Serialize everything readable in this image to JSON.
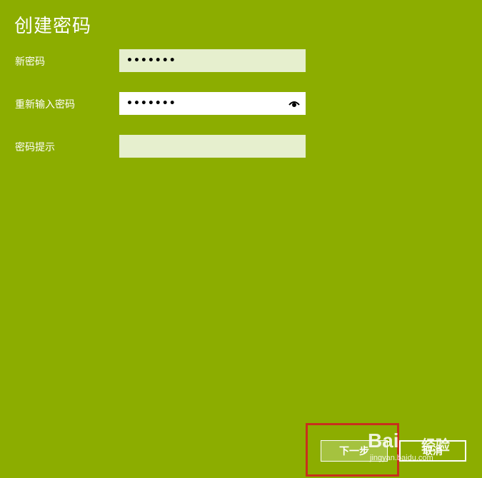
{
  "window": {
    "title": "创建密码"
  },
  "form": {
    "new_password": {
      "label": "新密码",
      "value": "•••••••"
    },
    "confirm_password": {
      "label": "重新输入密码",
      "value": "•••••••"
    },
    "hint": {
      "label": "密码提示",
      "value": ""
    }
  },
  "buttons": {
    "next": "下一步",
    "cancel": "取消"
  },
  "watermark": {
    "logo": "Bai",
    "text": "经验",
    "sub": "jingyan.baidu.com"
  },
  "colors": {
    "background": "#8cad00",
    "highlight": "#c8301d"
  }
}
